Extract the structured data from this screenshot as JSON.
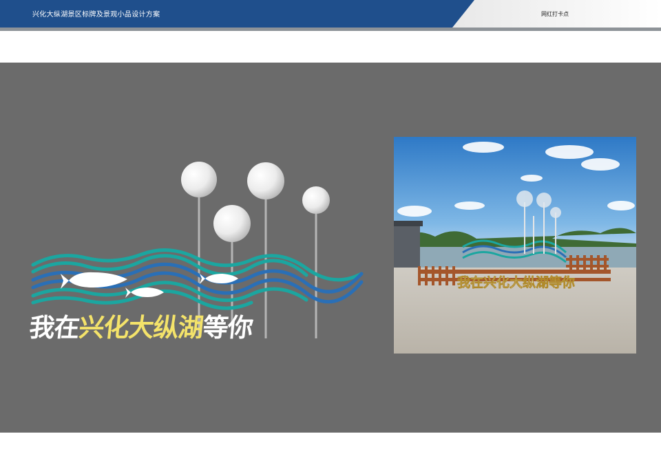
{
  "header": {
    "title": "兴化大纵湖景区标牌及景观小品设计方案",
    "section": "网红打卡点"
  },
  "design": {
    "slogan_part1": "我在",
    "slogan_part2": "兴化大纵湖",
    "slogan_part3": "等你",
    "colors": {
      "panel_bg": "#6b6b6b",
      "header_blue": "#1f4f8c",
      "wave_teal": "#1ba6a0",
      "wave_blue": "#2a6fb6",
      "slogan_yellow": "#f4e36a"
    }
  },
  "photo": {
    "sign_text": "我在兴化大纵湖等你"
  }
}
